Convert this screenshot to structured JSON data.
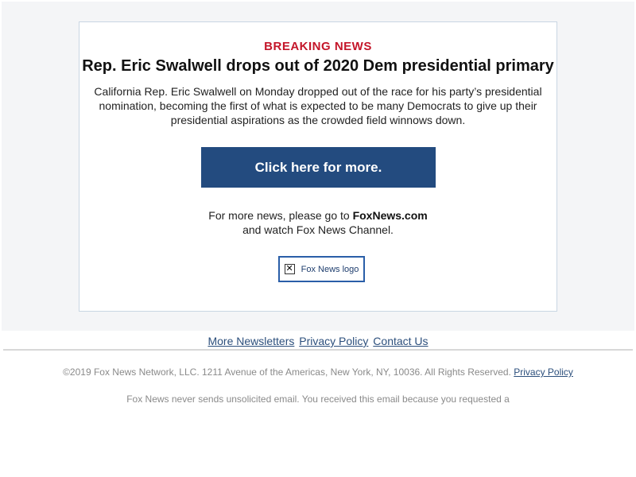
{
  "alert": {
    "kicker": "BREAKING NEWS",
    "headline": "Rep. Eric Swalwell drops out of 2020 Dem presidential primary",
    "body": "California Rep. Eric Swalwell on Monday dropped out of the race for his party’s presidential nomination, becoming the first of what is expected to be many Democrats to give up their presidential aspirations as the crowded field winnows down.",
    "cta_label": "Click here for more."
  },
  "more_news": {
    "prefix": "For more news, please go to ",
    "site": "FoxNews.com",
    "suffix": "and watch Fox News Channel."
  },
  "logo": {
    "alt_text": "Fox News logo",
    "icon": "broken-image-icon"
  },
  "footer": {
    "links": [
      "More Newsletters",
      "Privacy Policy",
      "Contact Us"
    ],
    "copyright": "©2019 Fox News Network, LLC. 1211 Avenue of the Americas, New York, NY, 10036. All Rights Reserved.",
    "copyright_link": "Privacy Policy",
    "disclaimer": "Fox News never sends unsolicited email. You received this email because you requested a"
  },
  "colors": {
    "kicker_red": "#c4162a",
    "cta_blue": "#234b7f",
    "link_blue": "#2c4f7c",
    "band_gray": "#f4f5f7"
  }
}
